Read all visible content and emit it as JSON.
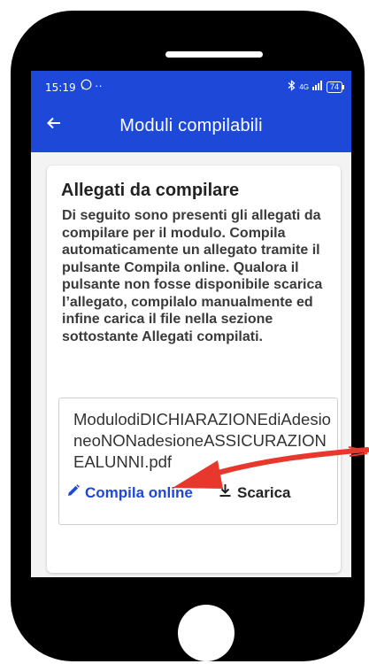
{
  "status_bar": {
    "time": "15:19",
    "whatsapp_icon": "whatsapp-icon",
    "dots": "··",
    "bluetooth_icon": "bluetooth-icon",
    "network": "4G",
    "battery": "74"
  },
  "app_bar": {
    "back_icon": "arrow-left-icon",
    "title": "Moduli compilabili"
  },
  "card": {
    "title": "Allegati da compilare",
    "description": "Di seguito sono presenti gli allegati da compilare per il modulo. Compila automaticamente un allegato tramite il pulsante Compila online. Qualora il pulsante non fosse disponibile scarica l’allegato, compilalo manualmente ed infine carica il file nella sezione sottostante Allegati compilati.",
    "file": {
      "name": "ModulodiDICHIARAZIONEdiAdesioneoNONadesioneASSICURAZIONEALUNNI.pdf",
      "compila_label": "Compila online",
      "scarica_label": "Scarica"
    }
  },
  "colors": {
    "primary": "#1e49d8",
    "annotation_arrow": "#e8382e"
  }
}
